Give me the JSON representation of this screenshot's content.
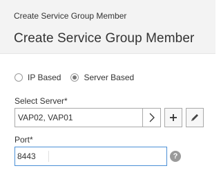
{
  "header": {
    "breadcrumb": "Create Service Group Member",
    "title": "Create Service Group Member"
  },
  "member_type": {
    "options": [
      {
        "label": "IP Based",
        "selected": false
      },
      {
        "label": "Server Based",
        "selected": true
      }
    ]
  },
  "server": {
    "label": "Select Server*",
    "value": "VAP02, VAP01",
    "chevron_icon": "chevron-right-icon",
    "add_icon": "plus-icon",
    "edit_icon": "pencil-icon"
  },
  "port": {
    "label": "Port*",
    "value": "8443",
    "help_glyph": "?"
  }
}
